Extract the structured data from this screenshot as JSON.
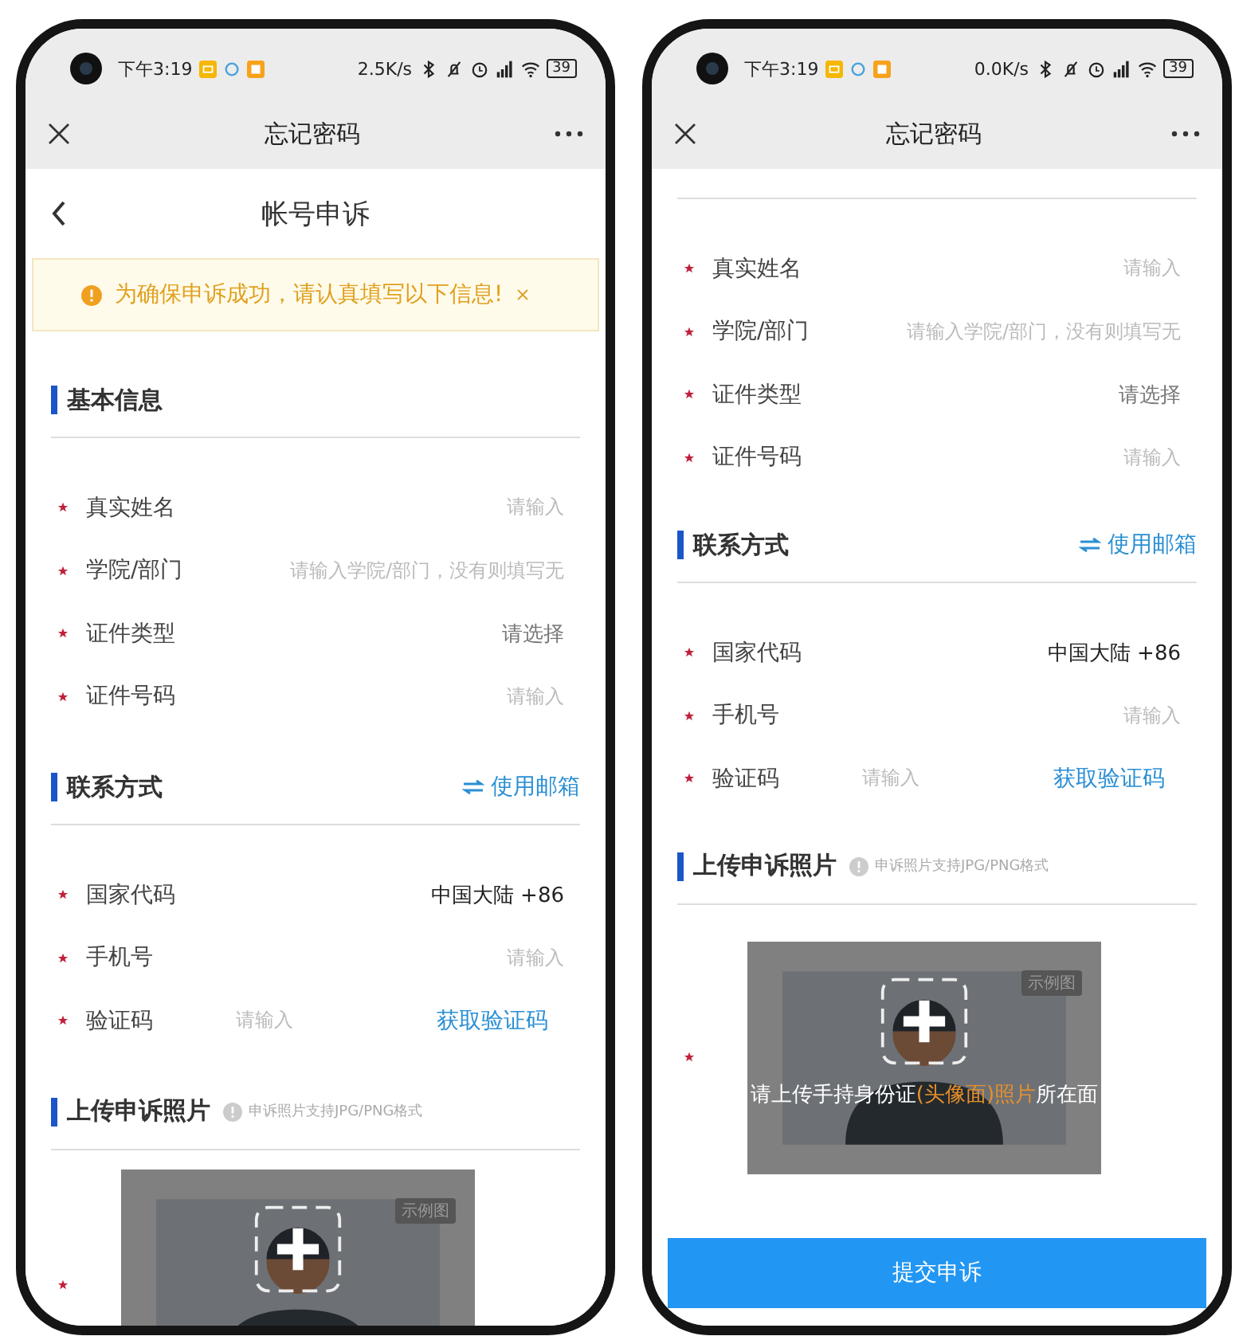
{
  "phones": [
    {
      "status_bar": {
        "time": "下午3:19",
        "speed": "2.5K/s",
        "battery": "39"
      },
      "nav": {
        "title": "忘记密码"
      },
      "blocks": [
        {
          "kind": "header",
          "title": "帐号申诉"
        },
        {
          "kind": "alert",
          "text": "为确保申诉成功，请认真填写以下信息!"
        },
        {
          "kind": "section",
          "title": "基本信息"
        },
        {
          "kind": "field",
          "label": "真实姓名",
          "required": true,
          "placeholder": "请输入"
        },
        {
          "kind": "field",
          "label": "学院/部门",
          "required": true,
          "placeholder": "请输入学院/部门，没有则填写无"
        },
        {
          "kind": "select",
          "label": "证件类型",
          "required": true,
          "placeholder": "请选择"
        },
        {
          "kind": "field",
          "label": "证件号码",
          "required": true,
          "placeholder": "请输入"
        },
        {
          "kind": "section",
          "title": "联系方式",
          "action": "使用邮箱"
        },
        {
          "kind": "field",
          "label": "国家代码",
          "required": true,
          "value": "中国大陆 +86"
        },
        {
          "kind": "field",
          "label": "手机号",
          "required": true,
          "placeholder": "请输入"
        },
        {
          "kind": "code",
          "label": "验证码",
          "required": true,
          "placeholder": "请输入",
          "action": "获取验证码"
        },
        {
          "kind": "section",
          "title": "上传申诉照片",
          "hint": "申诉照片支持JPG/PNG格式"
        },
        {
          "kind": "upload",
          "required": true,
          "badge": "示例图"
        }
      ]
    },
    {
      "status_bar": {
        "time": "下午3:19",
        "speed": "0.0K/s",
        "battery": "39"
      },
      "nav": {
        "title": "忘记密码"
      },
      "blocks": [
        {
          "kind": "divider"
        },
        {
          "kind": "field",
          "label": "真实姓名",
          "required": true,
          "placeholder": "请输入"
        },
        {
          "kind": "field",
          "label": "学院/部门",
          "required": true,
          "placeholder": "请输入学院/部门，没有则填写无"
        },
        {
          "kind": "select",
          "label": "证件类型",
          "required": true,
          "placeholder": "请选择"
        },
        {
          "kind": "field",
          "label": "证件号码",
          "required": true,
          "placeholder": "请输入"
        },
        {
          "kind": "section",
          "title": "联系方式",
          "action": "使用邮箱"
        },
        {
          "kind": "field",
          "label": "国家代码",
          "required": true,
          "value": "中国大陆 +86"
        },
        {
          "kind": "field",
          "label": "手机号",
          "required": true,
          "placeholder": "请输入"
        },
        {
          "kind": "code",
          "label": "验证码",
          "required": true,
          "placeholder": "请输入",
          "action": "获取验证码"
        },
        {
          "kind": "section",
          "title": "上传申诉照片",
          "hint": "申诉照片支持JPG/PNG格式"
        },
        {
          "kind": "upload",
          "required": true,
          "badge": "示例图",
          "caption": [
            {
              "text": "请上传手持身份证",
              "highlight": false
            },
            {
              "text": "(头像面)照片",
              "highlight": true
            },
            {
              "text": "所在面",
              "highlight": false
            }
          ]
        },
        {
          "kind": "submit",
          "label": "提交申诉"
        }
      ]
    }
  ]
}
